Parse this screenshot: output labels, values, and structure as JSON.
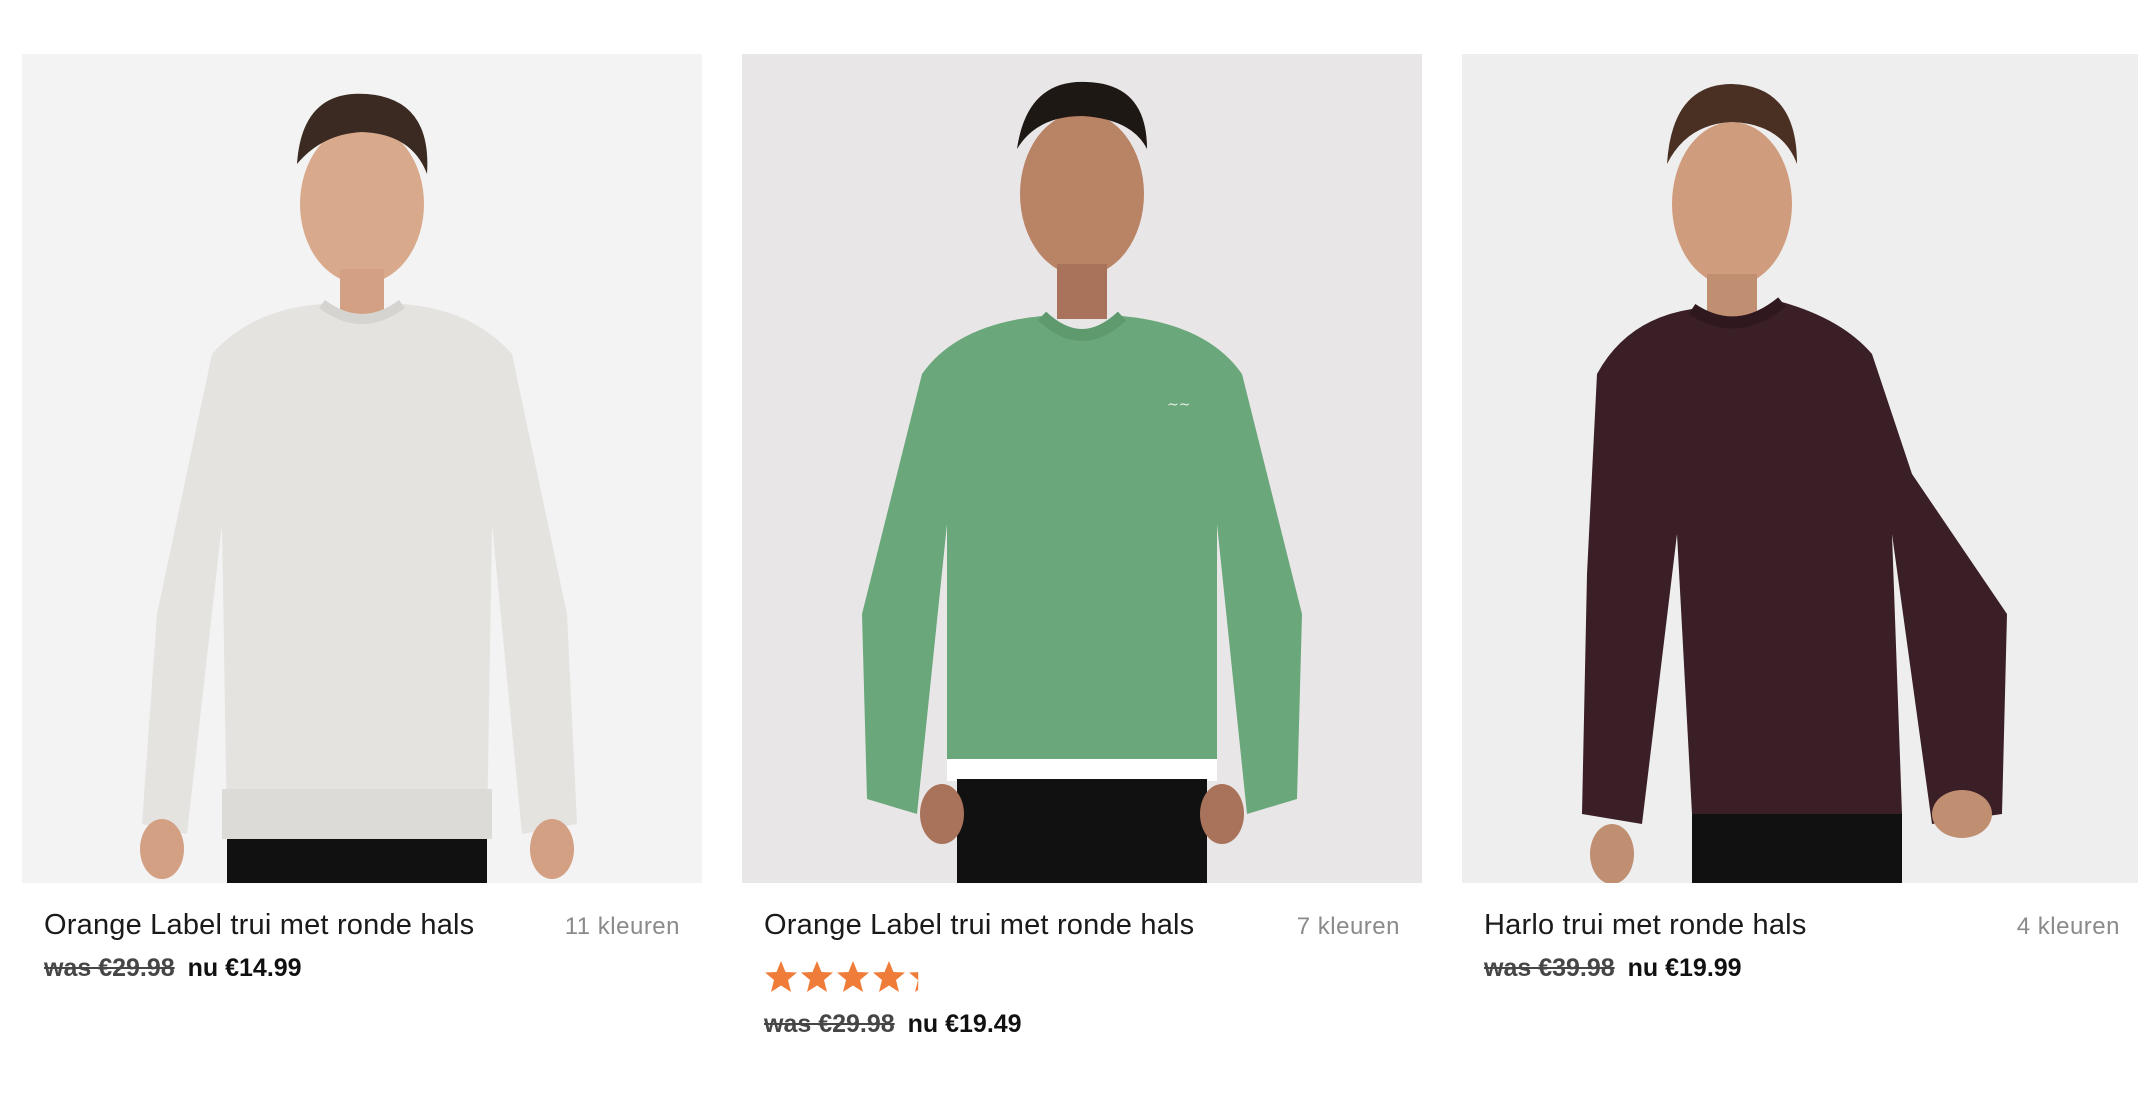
{
  "products": [
    {
      "name": "Orange Label trui met ronde hals",
      "colours": "11 kleuren",
      "price_was": "was €29.98",
      "price_now": "nu €14.99",
      "image_alt": "",
      "sweater_color": "#e4e3e0",
      "background_color": "#f3f3f3"
    },
    {
      "name": "Orange Label trui met ronde hals",
      "colours": "7 kleuren",
      "rating": 4.3,
      "rating_max": 5,
      "price_was": "was €29.98",
      "price_now": "nu €19.49",
      "sweater_color": "#6aa77a",
      "background_color": "#e9e6e7",
      "star_color": "#f07c3a"
    },
    {
      "name": "Harlo trui met ronde hals",
      "colours": "4 kleuren",
      "price_was": "was €39.98",
      "price_now": "nu €19.99",
      "sweater_color": "#3a1f26",
      "background_color": "#eeeeee"
    }
  ]
}
